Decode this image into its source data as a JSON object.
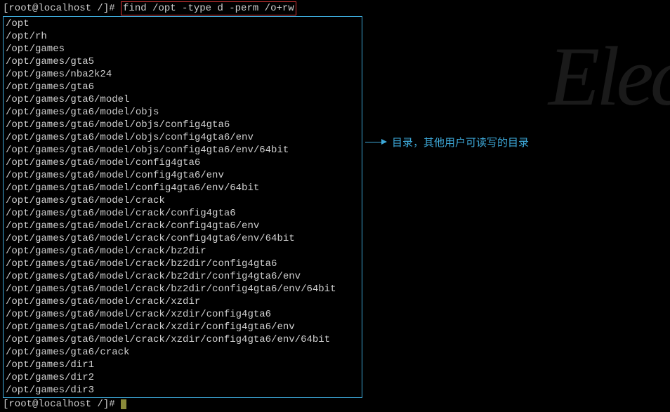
{
  "prompt1": {
    "text": "[root@localhost /]# ",
    "command": "find /opt -type d -perm /o+rw"
  },
  "output": [
    "/opt",
    "/opt/rh",
    "/opt/games",
    "/opt/games/gta5",
    "/opt/games/nba2k24",
    "/opt/games/gta6",
    "/opt/games/gta6/model",
    "/opt/games/gta6/model/objs",
    "/opt/games/gta6/model/objs/config4gta6",
    "/opt/games/gta6/model/objs/config4gta6/env",
    "/opt/games/gta6/model/objs/config4gta6/env/64bit",
    "/opt/games/gta6/model/config4gta6",
    "/opt/games/gta6/model/config4gta6/env",
    "/opt/games/gta6/model/config4gta6/env/64bit",
    "/opt/games/gta6/model/crack",
    "/opt/games/gta6/model/crack/config4gta6",
    "/opt/games/gta6/model/crack/config4gta6/env",
    "/opt/games/gta6/model/crack/config4gta6/env/64bit",
    "/opt/games/gta6/model/crack/bz2dir",
    "/opt/games/gta6/model/crack/bz2dir/config4gta6",
    "/opt/games/gta6/model/crack/bz2dir/config4gta6/env",
    "/opt/games/gta6/model/crack/bz2dir/config4gta6/env/64bit",
    "/opt/games/gta6/model/crack/xzdir",
    "/opt/games/gta6/model/crack/xzdir/config4gta6",
    "/opt/games/gta6/model/crack/xzdir/config4gta6/env",
    "/opt/games/gta6/model/crack/xzdir/config4gta6/env/64bit",
    "/opt/games/gta6/crack",
    "/opt/games/dir1",
    "/opt/games/dir2",
    "/opt/games/dir3"
  ],
  "prompt2": {
    "text": "[root@localhost /]# "
  },
  "annotation": {
    "text": "目录，其他用户可读写的目录"
  },
  "watermark": "Elec"
}
